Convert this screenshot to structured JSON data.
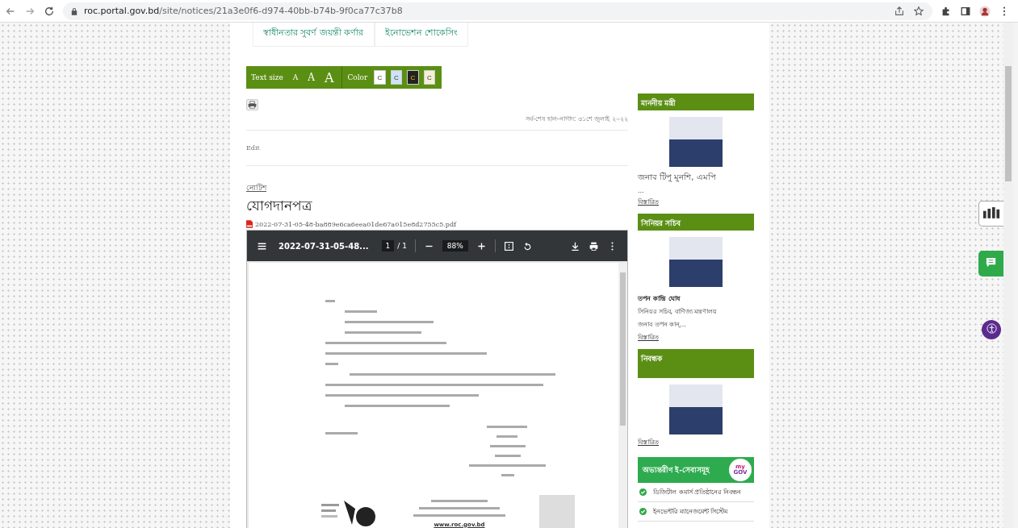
{
  "browser": {
    "url_host": "roc.portal.gov.bd",
    "url_path": "/site/notices/21a3e0f6-d974-40bb-b74b-9f0ca77c37b8"
  },
  "top_tabs": [
    {
      "label": "স্বাধীনতার সুবর্ণ জয়ন্তী কর্ণার"
    },
    {
      "label": "ইনোভেশন শোকেসিং"
    }
  ],
  "accessibility": {
    "text_size_label": "Text size",
    "sizes": [
      "A",
      "A",
      "A"
    ],
    "color_label": "Color",
    "color_options": [
      {
        "label": "C",
        "color": "#ffffff"
      },
      {
        "label": "C",
        "color": "#cfe2f7"
      },
      {
        "label": "C",
        "color": "#222222"
      },
      {
        "label": "C",
        "color": "#f3efd8"
      }
    ]
  },
  "last_updated": "সর্ব-শেষ হাল-নাগাদ: ৩১শে জুলাই ২০২২",
  "edit_link": "Edit",
  "category": "নোটিশ",
  "title": "যোগদানপত্র",
  "attachment": "2022-07-31-05-48-ba889e6ca6eea01de67a015e8d2755c5.pdf",
  "pdf_viewer": {
    "file_name": "2022-07-31-05-48...",
    "page": "1",
    "page_total": "/ 1",
    "zoom": "88%",
    "document_link": "www.roc.gov.bd"
  },
  "sidebar": [
    {
      "heading": "মাননীয় মন্ত্রী",
      "title_lines": [
        "জনাব টিপু মুনশি, এমপি",
        "..."
      ],
      "more": "বিস্তারিত"
    },
    {
      "heading": "সিনিয়র সচিব",
      "name": "তপন কান্তি ঘোষ",
      "title_lines": [
        "সিনিয়র সচিব, বাণিজ্য মন্ত্রণালয়",
        "জনাব তপন কান্..."
      ],
      "more": "বিস্তারিত"
    },
    {
      "heading": "নিবন্ধক",
      "tall": true,
      "more": "বিস্তারিত"
    }
  ],
  "eservices": {
    "heading": "অভ্যন্তরীণ ই-সেবাসমূহ",
    "badge_top": "my",
    "badge_bottom": "GOV",
    "items": [
      "ডিজিটাল কমার্স প্রতিষ্ঠানের নিবন্ধন",
      "ইনভেন্টরি ম্যানেজমেন্ট সিস্টেম"
    ]
  }
}
